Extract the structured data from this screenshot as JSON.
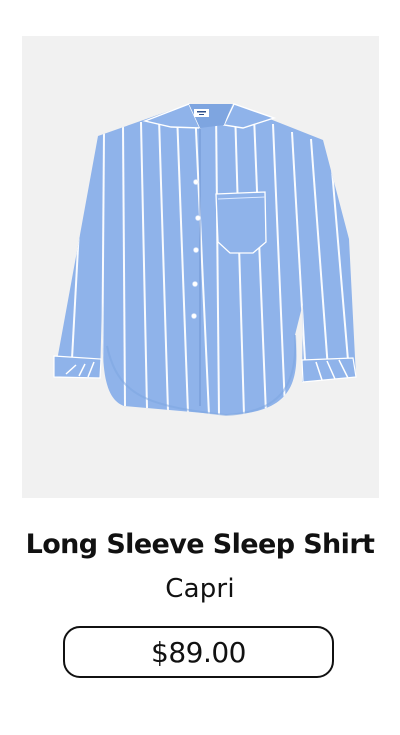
{
  "product": {
    "image_icon": "striped-long-sleeve-shirt-image",
    "name": "Long Sleeve Sleep Shirt",
    "variant": "Capri",
    "price": "$89.00"
  },
  "colors": {
    "background": "#ffffff",
    "image_background": "#f1f1f1",
    "shirt_blue": "#8fb3ea",
    "shirt_stripe": "#ffffff",
    "text": "#111111"
  }
}
